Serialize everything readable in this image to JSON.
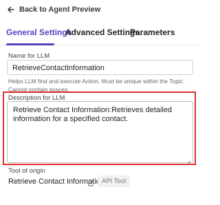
{
  "header": {
    "back_label": "Back to Agent Preview"
  },
  "tabs": [
    {
      "label": "General Settings",
      "active": true
    },
    {
      "label": "Advanced Settings",
      "active": false
    },
    {
      "label": "Parameters",
      "active": false
    }
  ],
  "name_field": {
    "label": "Name for LLM",
    "value": "RetrieveContactInformation",
    "helper": "Helps LLM find and execute Action. Must be unique within the Topic. Cannot contain spaces."
  },
  "description_field": {
    "label": "Description for LLM",
    "value": "Retrieve Contact Information:Retrieves detailed information for a specified contact."
  },
  "tool_origin": {
    "label": "Tool of origin",
    "name": "Retrieve Contact Information",
    "badge": "API Tool"
  },
  "colors": {
    "accent": "#5a3fc0",
    "highlight": "#e0302b"
  }
}
